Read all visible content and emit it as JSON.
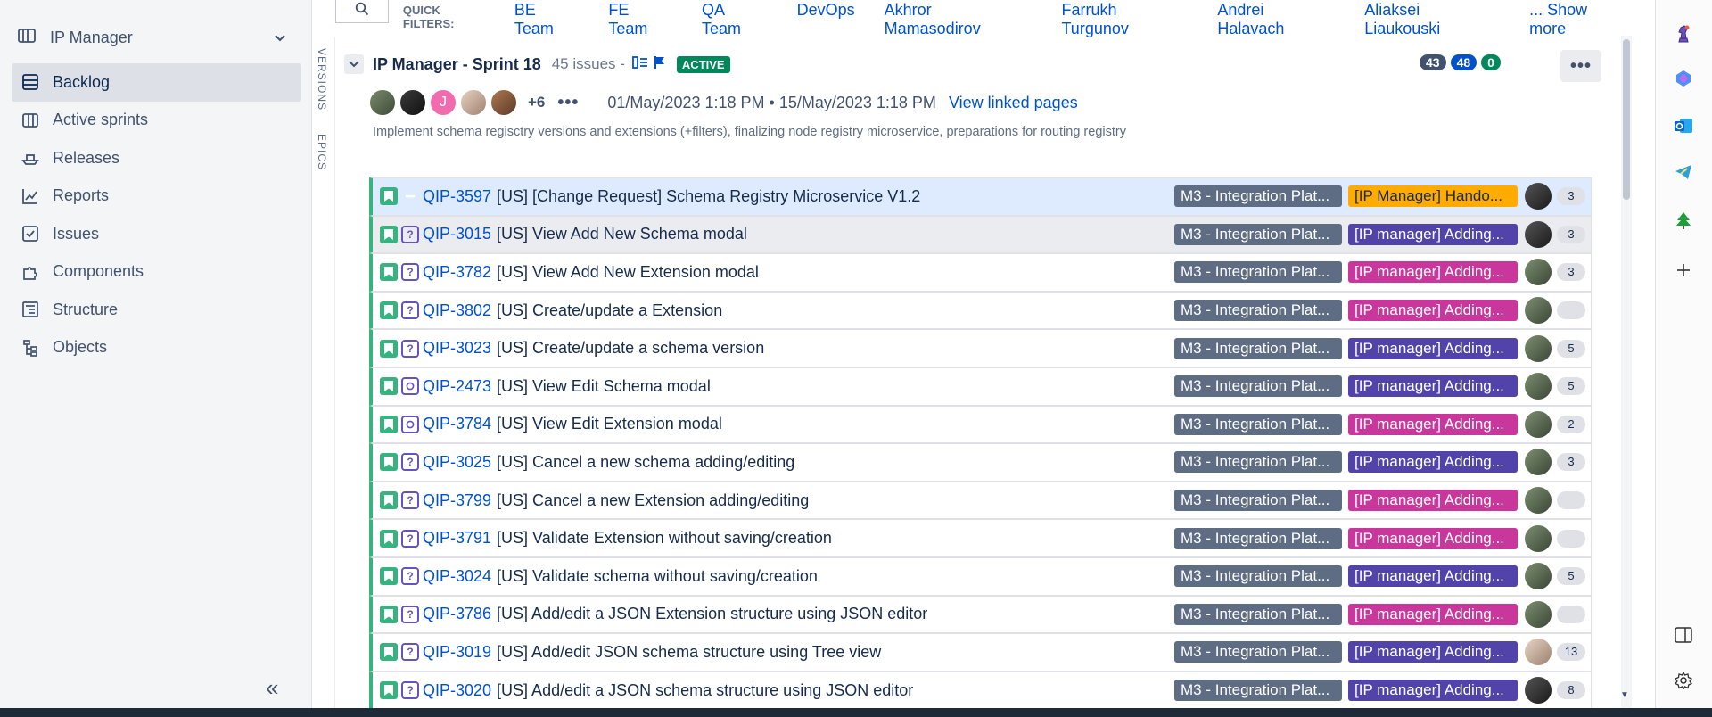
{
  "sidebar": {
    "project_name": "IP Manager",
    "items": [
      {
        "label": "Backlog",
        "icon": "backlog-icon",
        "active": true
      },
      {
        "label": "Active sprints",
        "icon": "board-icon",
        "active": false
      },
      {
        "label": "Releases",
        "icon": "ship-icon",
        "active": false
      },
      {
        "label": "Reports",
        "icon": "chart-icon",
        "active": false
      },
      {
        "label": "Issues",
        "icon": "issues-icon",
        "active": false
      },
      {
        "label": "Components",
        "icon": "puzzle-icon",
        "active": false
      },
      {
        "label": "Structure",
        "icon": "structure-icon",
        "active": false
      },
      {
        "label": "Objects",
        "icon": "tree-icon",
        "active": false
      }
    ]
  },
  "vtabs": {
    "versions": "VERSIONS",
    "epics": "EPICS"
  },
  "quick_filters": {
    "title": "QUICK FILTERS:",
    "items": [
      "BE Team",
      "FE Team",
      "QA Team",
      "DevOps",
      "Akhror Mamasodirov",
      "Farrukh Turgunov",
      "Andrei Halavach",
      "Aliaksei Liaukouski",
      "... Show more"
    ]
  },
  "sprint": {
    "name": "IP Manager - Sprint 18",
    "issue_count": "45 issues -",
    "status": "ACTIVE",
    "counts": [
      {
        "value": "43",
        "color": "#42526e"
      },
      {
        "value": "48",
        "color": "#0052cc"
      },
      {
        "value": "0",
        "color": "#00875a"
      }
    ],
    "more_assignees": "+6",
    "dates": "01/May/2023 1:18 PM • 15/May/2023 1:18 PM",
    "linked_pages": "View linked pages",
    "goal": "Implement schema regisctry versions and extensions (+filters), finalizing node registry microservice, preparations for routing registry"
  },
  "issues": [
    {
      "key": "QIP-3597",
      "summary": "[US] [Change Request] Schema Registry Microservice V1.2",
      "version": "M3 - Integration Plat...",
      "epic": "[IP Manager] Hando...",
      "epic_color": "#ffab00",
      "epic_text": "#172b4d",
      "priority": "blocker",
      "points": "3",
      "row": "sel"
    },
    {
      "key": "QIP-3015",
      "summary": "[US] View Add New Schema modal",
      "version": "M3 - Integration Plat...",
      "epic": "[IP manager] Adding...",
      "epic_color": "#5243aa",
      "epic_text": "#ffffff",
      "priority": "q",
      "points": "3",
      "row": "alt"
    },
    {
      "key": "QIP-3782",
      "summary": "[US] View Add New Extension modal",
      "version": "M3 - Integration Plat...",
      "epic": "[IP manager] Adding...",
      "epic_color": "#c9379d",
      "epic_text": "#ffffff",
      "priority": "q",
      "points": "3",
      "row": ""
    },
    {
      "key": "QIP-3802",
      "summary": "[US] Create/update a Extension",
      "version": "M3 - Integration Plat...",
      "epic": "[IP manager] Adding...",
      "epic_color": "#c9379d",
      "epic_text": "#ffffff",
      "priority": "q",
      "points": "",
      "row": ""
    },
    {
      "key": "QIP-3023",
      "summary": "[US] Create/update a schema version",
      "version": "M3 - Integration Plat...",
      "epic": "[IP manager] Adding...",
      "epic_color": "#5243aa",
      "epic_text": "#ffffff",
      "priority": "q",
      "points": "5",
      "row": ""
    },
    {
      "key": "QIP-2473",
      "summary": "[US] View Edit Schema modal",
      "version": "M3 - Integration Plat...",
      "epic": "[IP manager] Adding...",
      "epic_color": "#5243aa",
      "epic_text": "#ffffff",
      "priority": "circ",
      "points": "5",
      "row": ""
    },
    {
      "key": "QIP-3784",
      "summary": "[US] View Edit Extension modal",
      "version": "M3 - Integration Plat...",
      "epic": "[IP manager] Adding...",
      "epic_color": "#c9379d",
      "epic_text": "#ffffff",
      "priority": "circ",
      "points": "2",
      "row": ""
    },
    {
      "key": "QIP-3025",
      "summary": "[US] Cancel a new schema adding/editing",
      "version": "M3 - Integration Plat...",
      "epic": "[IP manager] Adding...",
      "epic_color": "#5243aa",
      "epic_text": "#ffffff",
      "priority": "q",
      "points": "3",
      "row": ""
    },
    {
      "key": "QIP-3799",
      "summary": "[US] Cancel a new Extension adding/editing",
      "version": "M3 - Integration Plat...",
      "epic": "[IP manager] Adding...",
      "epic_color": "#c9379d",
      "epic_text": "#ffffff",
      "priority": "q",
      "points": "",
      "row": ""
    },
    {
      "key": "QIP-3791",
      "summary": "[US] Validate Extension without saving/creation",
      "version": "M3 - Integration Plat...",
      "epic": "[IP manager] Adding...",
      "epic_color": "#c9379d",
      "epic_text": "#ffffff",
      "priority": "q",
      "points": "",
      "row": ""
    },
    {
      "key": "QIP-3024",
      "summary": "[US] Validate schema without saving/creation",
      "version": "M3 - Integration Plat...",
      "epic": "[IP manager] Adding...",
      "epic_color": "#5243aa",
      "epic_text": "#ffffff",
      "priority": "q",
      "points": "5",
      "row": ""
    },
    {
      "key": "QIP-3786",
      "summary": "[US] Add/edit a JSON Extension structure using JSON editor",
      "version": "M3 - Integration Plat...",
      "epic": "[IP manager] Adding...",
      "epic_color": "#c9379d",
      "epic_text": "#ffffff",
      "priority": "q",
      "points": "",
      "row": ""
    },
    {
      "key": "QIP-3019",
      "summary": "[US] Add/edit JSON schema structure using Tree view",
      "version": "M3 - Integration Plat...",
      "epic": "[IP manager] Adding...",
      "epic_color": "#5243aa",
      "epic_text": "#ffffff",
      "priority": "q",
      "points": "13",
      "row": ""
    },
    {
      "key": "QIP-3020",
      "summary": "[US] Add/edit a JSON schema structure using JSON editor",
      "version": "M3 - Integration Plat...",
      "epic": "[IP manager] Adding...",
      "epic_color": "#5243aa",
      "epic_text": "#ffffff",
      "priority": "q",
      "points": "8",
      "row": ""
    }
  ],
  "rail_icons": [
    "chess-icon",
    "copilot-icon",
    "outlook-icon",
    "telegram-icon",
    "tree-app-icon",
    "add-icon",
    "panel-icon",
    "settings-icon"
  ]
}
